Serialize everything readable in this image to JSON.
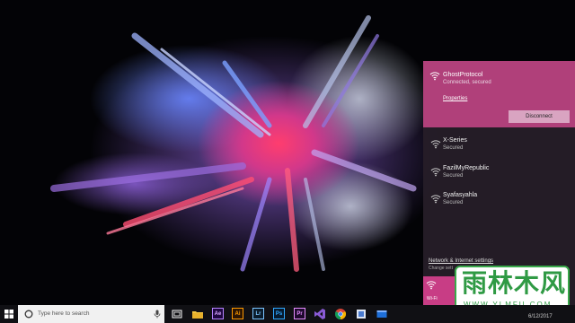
{
  "flyout": {
    "connected_network": {
      "name": "GhostProtocol",
      "status": "Connected, secured",
      "properties_link": "Properties",
      "disconnect_label": "Disconnect",
      "icon": "wifi-secured-icon"
    },
    "networks": [
      {
        "name": "X-Series",
        "status": "Secured",
        "icon": "wifi-secured-icon"
      },
      {
        "name": "FazilMyRepublic",
        "status": "Secured",
        "icon": "wifi-secured-icon"
      },
      {
        "name": "Syafasyahla",
        "status": "Secured",
        "icon": "wifi-secured-icon"
      }
    ],
    "settings_title": "Network & Internet settings",
    "settings_subtitle": "Change sett",
    "wifi_tile_label": "Wi-Fi",
    "accent_color": "#b0407a"
  },
  "taskbar": {
    "search_placeholder": "Type here to search",
    "apps": [
      {
        "name": "task-view-icon"
      },
      {
        "name": "file-explorer-icon"
      },
      {
        "name": "after-effects-icon",
        "label": "Ae"
      },
      {
        "name": "illustrator-icon",
        "label": "Ai"
      },
      {
        "name": "lightroom-icon",
        "label": "Lr"
      },
      {
        "name": "photoshop-icon",
        "label": "Ps"
      },
      {
        "name": "premiere-icon",
        "label": "Pr"
      },
      {
        "name": "visual-studio-icon"
      },
      {
        "name": "chrome-icon"
      },
      {
        "name": "app-icon"
      },
      {
        "name": "window-app-icon"
      }
    ],
    "clock": "6/12/2017"
  },
  "watermark": {
    "text": "雨林木风",
    "url": "WWW.YLMFU.COM"
  }
}
